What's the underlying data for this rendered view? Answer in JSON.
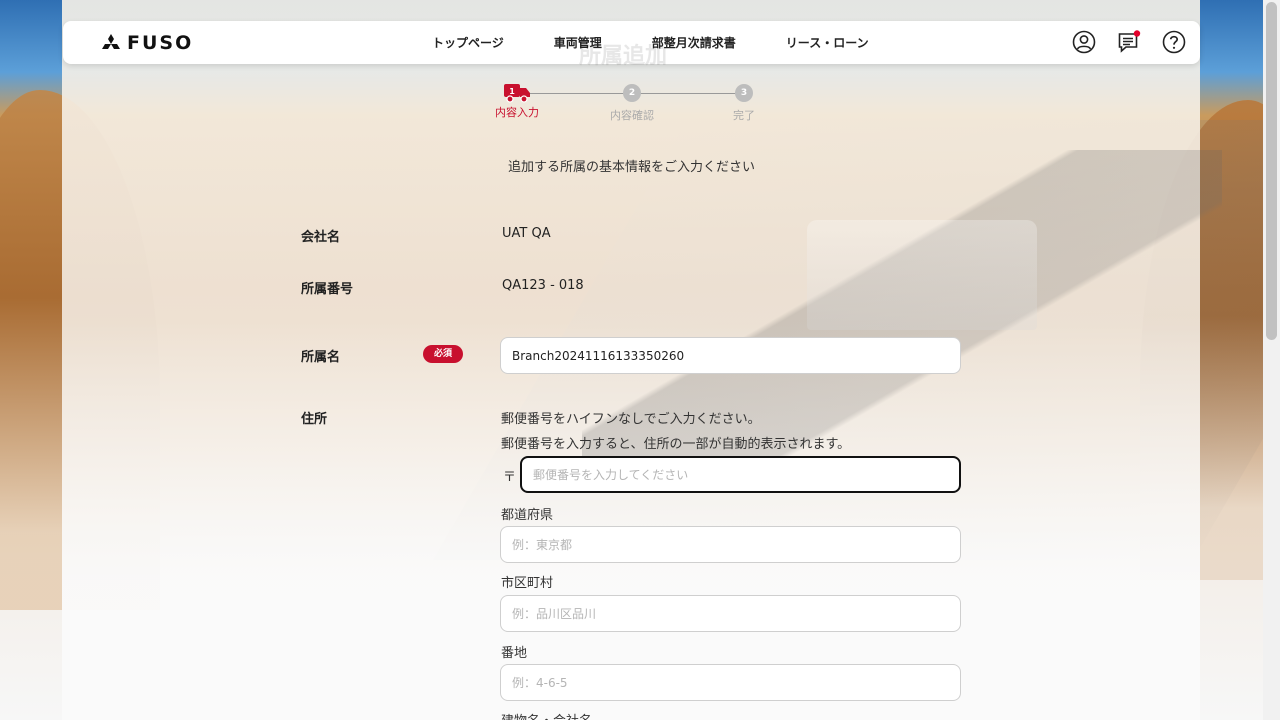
{
  "app": {
    "brand": "FUSO",
    "ghost_title": "所属追加"
  },
  "header": {
    "nav": [
      "トップページ",
      "車両管理",
      "部整月次請求書",
      "リース・ローン"
    ],
    "icons": [
      "account-icon",
      "message-icon",
      "help-icon"
    ],
    "notification_color": "#e4002b"
  },
  "stepper": {
    "steps": [
      {
        "num": "1",
        "label": "内容入力",
        "active": true
      },
      {
        "num": "2",
        "label": "内容確認",
        "active": false
      },
      {
        "num": "3",
        "label": "完了",
        "active": false
      }
    ]
  },
  "form": {
    "intro": "追加する所属の基本情報をご入力ください",
    "company_label": "会社名",
    "company_value": "UAT QA",
    "branch_no_label": "所属番号",
    "branch_no_value": "QA123 - 018",
    "branch_name_label": "所属名",
    "required_badge": "必須",
    "branch_name_value": "Branch20241116133350260",
    "address_label": "住所",
    "postal_help1": "郵便番号をハイフンなしでご入力ください。",
    "postal_help2": "郵便番号を入力すると、住所の一部が自動的表示されます。",
    "postal_mark": "〒",
    "postal_placeholder": "郵便番号を入力してください",
    "prefecture_label": "都道府県",
    "prefecture_placeholder": "例：東京都",
    "city_label": "市区町村",
    "city_placeholder": "例：品川区品川",
    "block_label": "番地",
    "block_placeholder": "例：4-6-5",
    "building_label": "建物名・会社名"
  },
  "colors": {
    "accent": "#c8102e",
    "inactive": "#bdbdbd"
  }
}
